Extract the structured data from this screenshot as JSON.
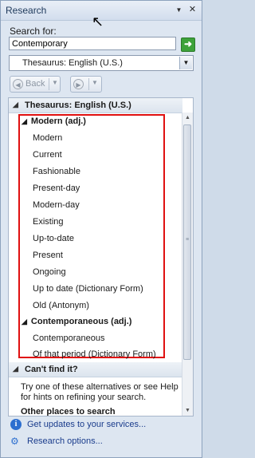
{
  "pane": {
    "title": "Research",
    "dropdown_glyph": "▼",
    "close_glyph": "✕"
  },
  "search": {
    "label": "Search for:",
    "value": "Contemporary",
    "go_glyph": "➜"
  },
  "source_select": {
    "selected": "Thesaurus: English (U.S.)",
    "arrow": "▼"
  },
  "nav": {
    "back_label": "Back",
    "back_glyph": "◀",
    "forward_glyph": "▶",
    "dropdown_glyph": "▼"
  },
  "results": {
    "header": "Thesaurus: English (U.S.)",
    "header_glyph": "◢",
    "categories": [
      {
        "label": "Modern (adj.)",
        "glyph": "◢",
        "items": [
          "Modern",
          "Current",
          "Fashionable",
          "Present-day",
          "Modern-day",
          "Existing",
          "Up-to-date",
          "Present",
          "Ongoing",
          "Up to date (Dictionary Form)",
          "Old (Antonym)"
        ]
      },
      {
        "label": "Contemporaneous (adj.)",
        "glyph": "◢",
        "items": [
          "Contemporaneous",
          "Of that period (Dictionary Form)"
        ]
      }
    ],
    "cant_find": {
      "header": "Can't find it?",
      "glyph": "◢",
      "help": "Try one of these alternatives or see Help for hints on refining your search.",
      "other_places": "Other places to search"
    }
  },
  "footer": {
    "updates_link": "Get updates to your services...",
    "options_link": "Research options..."
  },
  "colors": {
    "highlight_border": "#e01010",
    "link": "#1a3c8c",
    "go_button": "#3da23a"
  }
}
